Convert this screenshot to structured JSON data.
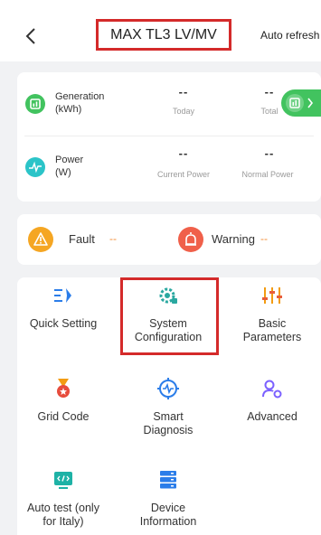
{
  "header": {
    "title": "MAX TL3 LV/MV",
    "auto_refresh": "Auto refresh"
  },
  "metrics": {
    "generation": {
      "label_line1": "Generation",
      "label_line2": "(kWh)",
      "today_value": "--",
      "today_label": "Today",
      "total_value": "--",
      "total_label": "Total"
    },
    "power": {
      "label_line1": "Power",
      "label_line2": "(W)",
      "current_value": "--",
      "current_label": "Current Power",
      "normal_value": "--",
      "normal_label": "Normal Power"
    }
  },
  "status": {
    "fault_label": "Fault",
    "fault_value": "--",
    "warning_label": "Warning",
    "warning_value": "--"
  },
  "tools": [
    {
      "line1": "Quick Setting",
      "line2": ""
    },
    {
      "line1": "System",
      "line2": "Configuration"
    },
    {
      "line1": "Basic",
      "line2": "Parameters"
    },
    {
      "line1": "Grid Code",
      "line2": ""
    },
    {
      "line1": "Smart",
      "line2": "Diagnosis"
    },
    {
      "line1": "Advanced",
      "line2": ""
    },
    {
      "line1": "Auto test (only",
      "line2": "for Italy)"
    },
    {
      "line1": "Device",
      "line2": "Information"
    }
  ],
  "colors": {
    "highlight": "#d42a2a",
    "green": "#42c35f",
    "blue": "#2b7de9",
    "orange": "#f5a623",
    "red": "#e74c3c"
  }
}
